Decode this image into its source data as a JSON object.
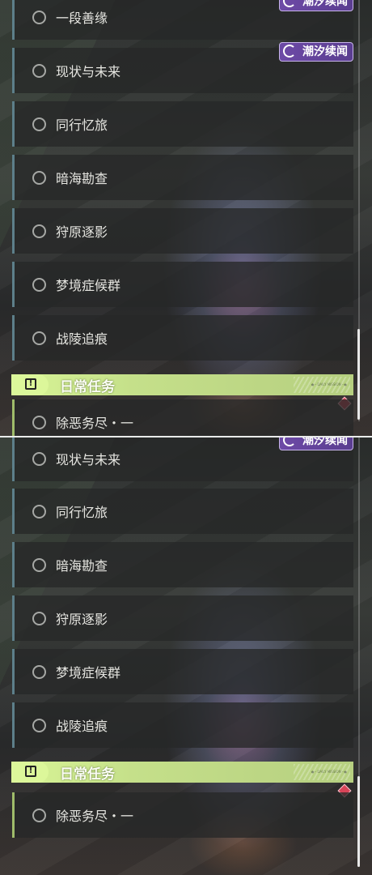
{
  "event_tag": {
    "label": "潮汐续闻",
    "icon": "tide-swirl-icon"
  },
  "screen_a": {
    "quests": [
      {
        "label": "一段善缘"
      },
      {
        "label": "现状与未来"
      },
      {
        "label": "同行忆旅"
      },
      {
        "label": "暗海勘查"
      },
      {
        "label": "狩原逐影"
      },
      {
        "label": "梦境症候群"
      },
      {
        "label": "战陵追痕"
      }
    ],
    "section": {
      "title": "日常任务",
      "tiny_text": "●·· DAILY MISSION ··●"
    },
    "daily_quest": {
      "label": "除恶务尽・一"
    }
  },
  "screen_b": {
    "quests": [
      {
        "label": "现状与未来"
      },
      {
        "label": "同行忆旅"
      },
      {
        "label": "暗海勘查"
      },
      {
        "label": "狩原逐影"
      },
      {
        "label": "梦境症候群"
      },
      {
        "label": "战陵追痕"
      }
    ],
    "section": {
      "title": "日常任务",
      "tiny_text": "●·· DAILY MISSION ··●"
    },
    "daily_quest": {
      "label": "除恶务尽・一"
    }
  },
  "colors": {
    "accent_green": "#c5e08a",
    "quest_border": "#5d7f8a",
    "event_purple": "#6d4aa6",
    "notify_red": "#d84458"
  }
}
